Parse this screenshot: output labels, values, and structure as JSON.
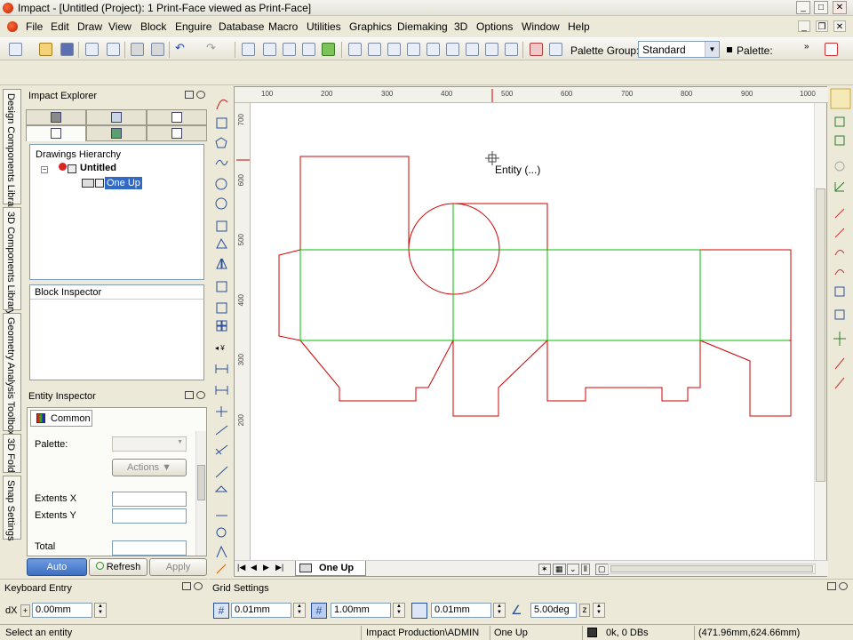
{
  "window": {
    "title": "Impact - [Untitled (Project): 1 Print-Face viewed as  Print-Face]",
    "minimize": "_",
    "maximize": "□",
    "close": "✕"
  },
  "menu": [
    "File",
    "Edit",
    "Draw",
    "View",
    "Block",
    "Enguire",
    "Database",
    "Macro",
    "Utilities",
    "Graphics",
    "Diemaking",
    "3D",
    "Options",
    "Window",
    "Help"
  ],
  "toolbar": {
    "palette_group_label": "Palette Group:",
    "palette_group_value": "Standard",
    "palette_label": "Palette:"
  },
  "vtabs": [
    "Design Components Library",
    "3D Components Library",
    "Geometry Analysis Toolbox",
    "3D Fold",
    "Snap Settings"
  ],
  "explorer": {
    "title": "Impact Explorer",
    "hierarchy_label": "Drawings Hierarchy",
    "root_node": "Untitled",
    "child_node": "One Up"
  },
  "block_inspector": {
    "title": "Block Inspector"
  },
  "entity_inspector": {
    "title": "Entity Inspector",
    "tab": "Common",
    "palette_label": "Palette:",
    "actions_label": "Actions",
    "extents_x_label": "Extents X",
    "extents_y_label": "Extents Y",
    "total_label": "Total",
    "auto_label": "Auto",
    "refresh_label": "Refresh",
    "apply_label": "Apply"
  },
  "canvas": {
    "cursor_label": "Entity (...)",
    "sheet_tab": "One Up",
    "h_ruler_ticks": [
      "100",
      "200",
      "300",
      "400",
      "500",
      "600",
      "700",
      "800",
      "900",
      "1000"
    ],
    "v_ruler_ticks": [
      "700",
      "600",
      "500",
      "400",
      "300",
      "200"
    ]
  },
  "keyboard_entry": {
    "title": "Keyboard Entry",
    "dx_label": "dX",
    "dx_value": "0.00mm"
  },
  "grid_settings": {
    "title": "Grid Settings",
    "value1": "0.01mm",
    "value2": "1.00mm",
    "value3": "0.01mm",
    "angle": "5.00deg"
  },
  "status": {
    "message": "Select an entity",
    "user": "Impact Production\\ADMIN",
    "sheet": "One Up",
    "db": "0k, 0 DBs",
    "coords": "(471.96mm,624.66mm)"
  },
  "colors": {
    "cut_line": "#d00000",
    "crease_line": "#00c000",
    "selection": "#316ac5"
  }
}
